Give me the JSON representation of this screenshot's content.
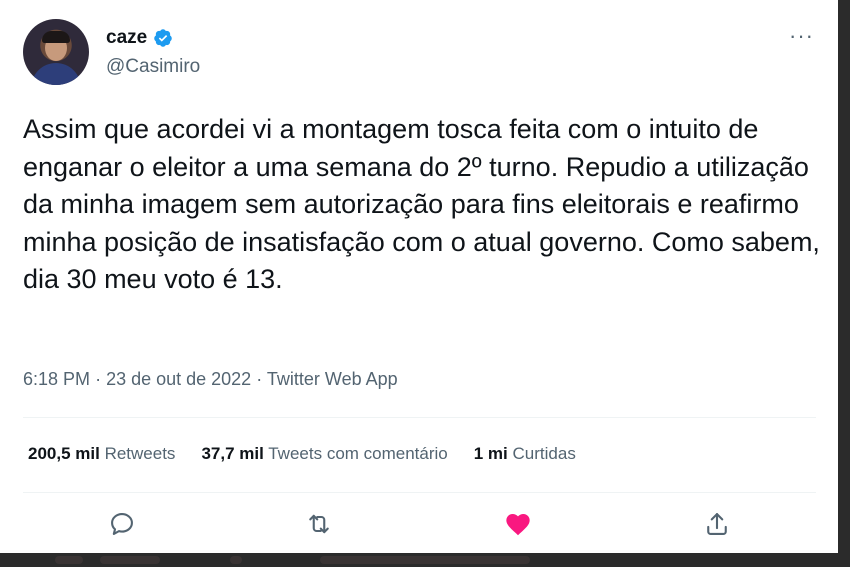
{
  "tweet": {
    "display_name": "caze",
    "handle": "@Casimiro",
    "text": "Assim que acordei vi a montagem tosca feita com o intuito de enganar o eleitor a uma semana do 2º turno. Repudio a utilização da minha imagem sem autorização para fins eleitorais e reafirmo minha posição de insatisfação com o atual governo. Como sabem, dia 30 meu voto é 13.",
    "time": "6:18 PM",
    "date": "23 de out de 2022",
    "source": "Twitter Web App",
    "more_label": "···"
  },
  "stats": {
    "retweets_count": "200,5 mil",
    "retweets_label": "Retweets",
    "quotes_count": "37,7 mil",
    "quotes_label": "Tweets com comentário",
    "likes_count": "1 mi",
    "likes_label": "Curtidas"
  },
  "icons": {
    "verified": "verified-badge-icon",
    "reply": "reply-icon",
    "retweet": "retweet-icon",
    "like": "heart-icon",
    "share": "share-icon"
  },
  "colors": {
    "verified": "#1d9bf0",
    "liked": "#f91880",
    "text": "#0f1419",
    "secondary": "#536471"
  }
}
